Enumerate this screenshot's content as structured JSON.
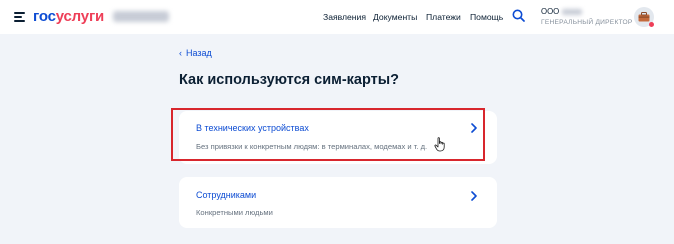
{
  "header": {
    "logo": {
      "part1": "гос",
      "part2": "услуги"
    },
    "nav": [
      "Заявления",
      "Документы",
      "Платежи",
      "Помощь"
    ],
    "org_name": "ООО",
    "org_role": "ГЕНЕРАЛЬНЫЙ ДИРЕКТОР"
  },
  "back_label": "Назад",
  "page_title": "Как используются сим-карты?",
  "options": [
    {
      "title": "В технических устройствах",
      "description": "Без привязки к конкретным людям: в терминалах, модемах и т. д."
    },
    {
      "title": "Сотрудниками",
      "description": "Конкретными людьми"
    }
  ],
  "colors": {
    "accent": "#0d4cd3",
    "brand_red": "#ee3f58",
    "highlight": "#d8262d"
  },
  "icons": [
    "menu-icon",
    "search-icon",
    "avatar-icon",
    "chevron-left-icon",
    "chevron-right-icon",
    "hand-cursor-icon"
  ]
}
